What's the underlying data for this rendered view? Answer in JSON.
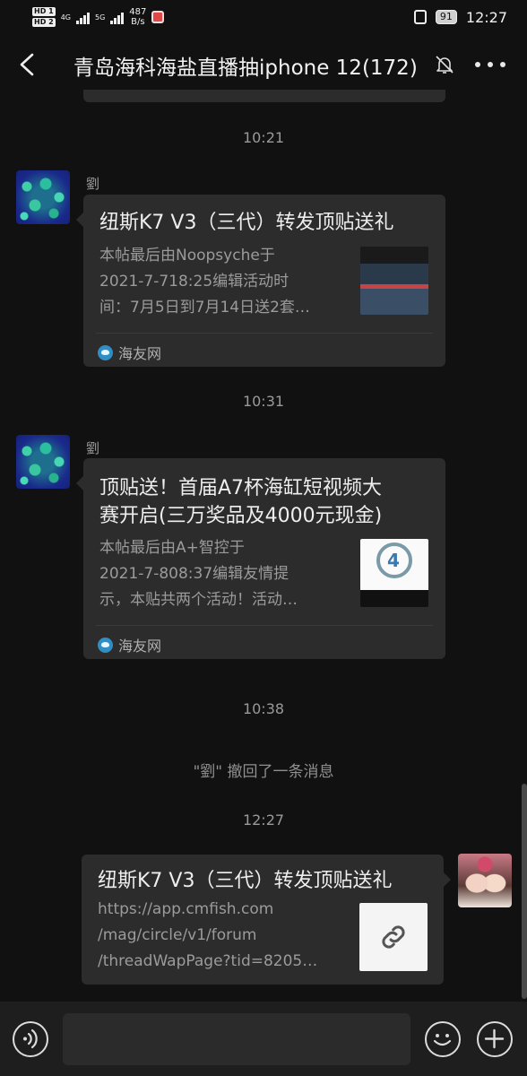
{
  "status_bar": {
    "hd1": "HD 1",
    "hd2": "HD 2",
    "net1": "4G",
    "net2": "5G",
    "speed_value": "487",
    "speed_unit": "B/s",
    "battery": "91",
    "time": "12:27"
  },
  "header": {
    "title": "青岛海科海盐直播抽iphone 12(172)",
    "back_icon": "chevron-left-icon",
    "mute_icon": "bell-off-icon",
    "more_icon": "more-dots-icon"
  },
  "messages": [
    {
      "time": "10:21",
      "sender": "劉",
      "card_title": "纽斯K7 V3（三代）转发顶贴送礼",
      "desc_lines": [
        "本帖最后由Noopsyche于",
        "2021-7-718:25编辑活动时",
        "间：7月5日到7月14日送2套…"
      ],
      "source": "海友网"
    },
    {
      "time": "10:31",
      "sender": "劉",
      "card_title_lines": [
        "顶贴送！首届A7杯海缸短视频大",
        "赛开启(三万奖品及4000元现金)"
      ],
      "desc_lines": [
        "本帖最后由A+智控于",
        "2021-7-808:37编辑友情提",
        "示，本贴共两个活动！活动…"
      ],
      "source": "海友网"
    }
  ],
  "recall_time": "10:38",
  "recall_notice": "\"劉\" 撤回了一条消息",
  "own_message": {
    "time": "12:27",
    "card_title": "纽斯K7 V3（三代）转发顶贴送礼",
    "desc_lines": [
      "https://app.cmfish.com",
      "/mag/circle/v1/forum",
      "/threadWapPage?tid=8205…"
    ],
    "thumb_icon": "link-icon"
  },
  "input_bar": {
    "voice_icon": "voice-icon",
    "emoji_icon": "emoji-icon",
    "plus_icon": "plus-icon"
  },
  "colors": {
    "background": "#111111",
    "card": "#2c2c2c",
    "bottom_bar": "#1e1e1e"
  }
}
